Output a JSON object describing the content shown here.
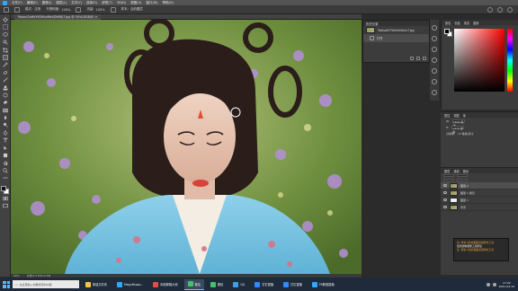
{
  "menubar": {
    "items": [
      "文件(F)",
      "编辑(E)",
      "图像(I)",
      "图层(L)",
      "文字(Y)",
      "选择(S)",
      "滤镜(T)",
      "3D(D)",
      "视图(V)",
      "窗口(W)",
      "帮助(H)"
    ]
  },
  "options": {
    "mode_label": "模式:",
    "mode_value": "正常",
    "opacity_label": "不透明度:",
    "opacity_value": "100%",
    "flow_label": "流量:",
    "flow_value": "100%",
    "sample_label": "样本:",
    "sample_value": "当前图层"
  },
  "document": {
    "tab_title": "Moon(SeWrYKSHhaMei(DWRJJT.jpg @ 50%(RGB/8) ×"
  },
  "history_panel": {
    "title": "历史记录",
    "snapshot": "TwKuoEV7b9e9rbtUuT.jpg",
    "step": "打开"
  },
  "color_panel": {
    "tabs": [
      "颜色",
      "色板",
      "渐变",
      "图案"
    ]
  },
  "properties_panel": {
    "tabs": [
      "属性",
      "调整",
      "库"
    ],
    "rows": [
      {
        "label": "W:",
        "value": "1600 像素"
      },
      {
        "label": "H:",
        "value": "1479 像素"
      },
      {
        "label": "分辨率:",
        "value": "72 像素/英寸"
      }
    ]
  },
  "layers_panel": {
    "tabs": [
      "图层",
      "通道",
      "路径"
    ],
    "layers": [
      {
        "name": "图层 2",
        "white": false
      },
      {
        "name": "图层 1 拷贝",
        "white": false
      },
      {
        "name": "图层 1",
        "white": true
      },
      {
        "name": "背景",
        "white": false
      }
    ],
    "notice": [
      {
        "text": "注: 修复人脸的瑕疵使用修补工具",
        "accent": true
      },
      {
        "text": "使用仿制图章工具修复",
        "accent": false
      },
      {
        "text": "注: 修复人脸的瑕疵使用修补工具",
        "accent": true
      }
    ]
  },
  "status": {
    "zoom": "50%",
    "doc_info": "文档:6.77M/13.5M"
  },
  "taskbar": {
    "search_placeholder": "在这里输入你要搜索的内容",
    "tasks": [
      {
        "label": "新建文件夹",
        "color": "#f5c542",
        "active": false
      },
      {
        "label": "MeguMuoor...",
        "color": "#31a8ff",
        "active": false
      },
      {
        "label": "网易邮箱大师",
        "color": "#e44c4c",
        "active": false
      },
      {
        "label": "微信",
        "color": "#45c267",
        "active": true
      },
      {
        "label": "微信",
        "color": "#45c267",
        "active": false
      },
      {
        "label": "QQ",
        "color": "#3aa0e8",
        "active": false
      },
      {
        "label": "钉钉直播",
        "color": "#2f8bff",
        "active": false
      },
      {
        "label": "钉钉直播",
        "color": "#2f8bff",
        "active": false
      },
      {
        "label": "PS教程直播",
        "color": "#31a8ff",
        "active": false
      }
    ],
    "time": "17:02",
    "date": "2021-04-19"
  }
}
